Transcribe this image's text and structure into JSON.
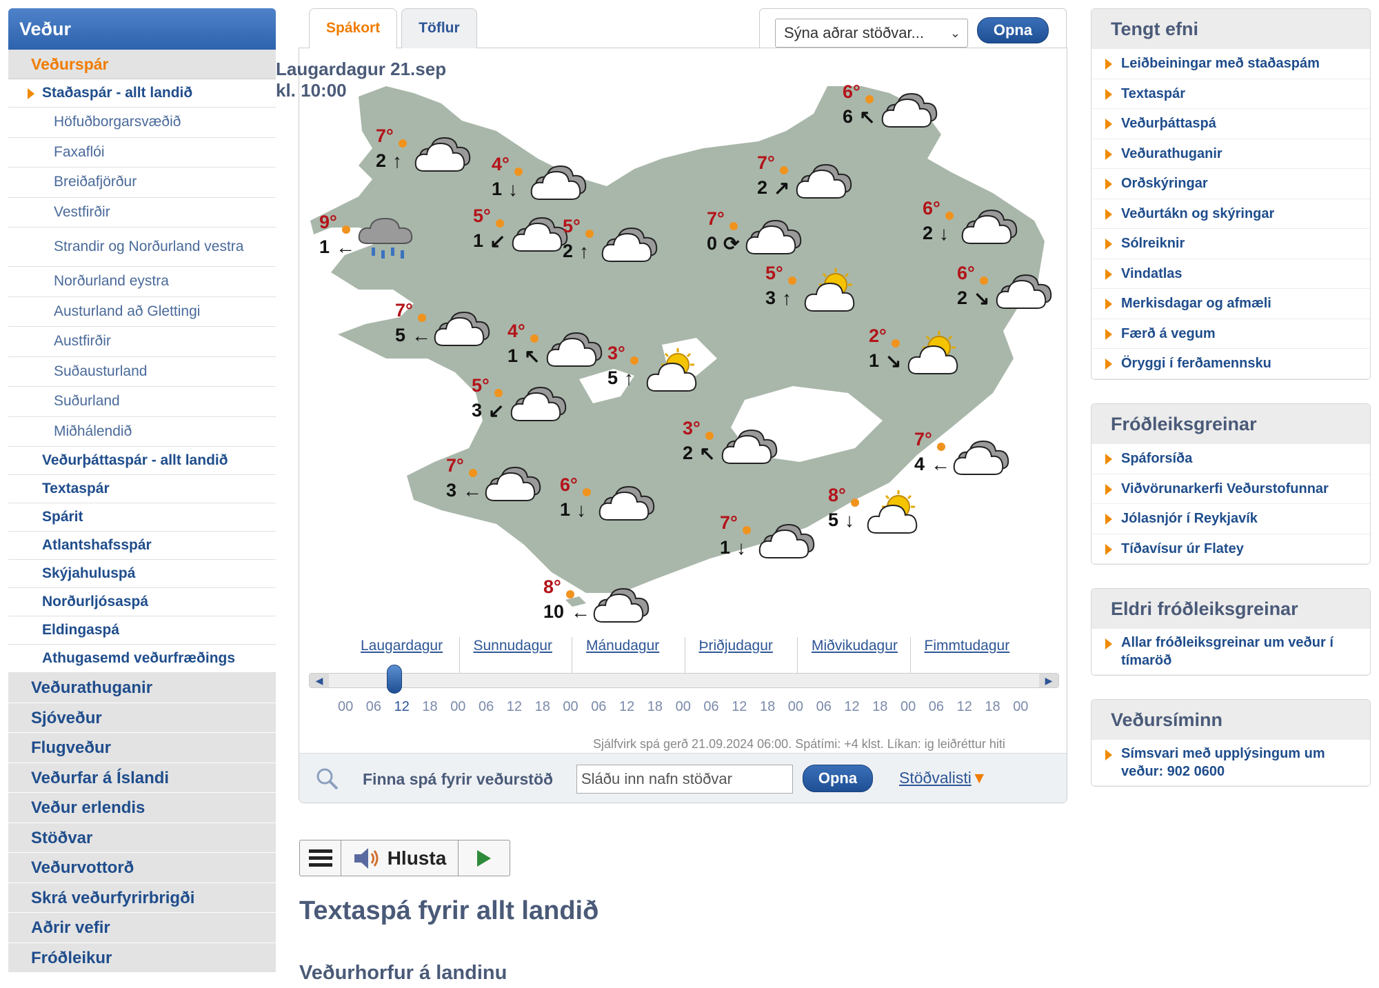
{
  "sidebar": {
    "header": "Veður",
    "section": "Veðurspár",
    "items": [
      {
        "label": "Staðaspár - allt landið",
        "level": 1,
        "active": true
      },
      {
        "label": "Höfuðborgarsvæðið",
        "level": 2
      },
      {
        "label": "Faxaflói",
        "level": 2
      },
      {
        "label": "Breiðafjörður",
        "level": 2
      },
      {
        "label": "Vestfirðir",
        "level": 2
      },
      {
        "label": "Strandir og Norðurland vestra",
        "level": 2
      },
      {
        "label": "Norðurland eystra",
        "level": 2
      },
      {
        "label": "Austurland að Glettingi",
        "level": 2
      },
      {
        "label": "Austfirðir",
        "level": 2
      },
      {
        "label": "Suðausturland",
        "level": 2
      },
      {
        "label": "Suðurland",
        "level": 2
      },
      {
        "label": "Miðhálendið",
        "level": 2
      },
      {
        "label": "Veðurþáttaspár - allt landið",
        "level": 1
      },
      {
        "label": "Textaspár",
        "level": 1
      },
      {
        "label": "Spárit",
        "level": 1
      },
      {
        "label": "Atlantshafsspár",
        "level": 1
      },
      {
        "label": "Skýjahuluspá",
        "level": 1
      },
      {
        "label": "Norðurljósaspá",
        "level": 1
      },
      {
        "label": "Eldingaspá",
        "level": 1
      },
      {
        "label": "Athugasemd veðurfræðings",
        "level": 1
      }
    ],
    "main": [
      "Veðurathuganir",
      "Sjóveður",
      "Flugveður",
      "Veðurfar á Íslandi",
      "Veður erlendis",
      "Stöðvar",
      "Veðurvottorð",
      "Skrá veðurfyrirbrigði",
      "Aðrir vefir",
      "Fróðleikur"
    ]
  },
  "map": {
    "tabs": [
      "Spákort",
      "Töflur"
    ],
    "station_select": "Sýna aðrar stöðvar...",
    "open_btn": "Opna",
    "title_line1": "Laugardagur 21.sep",
    "title_line2": "kl. 10:00",
    "stations": [
      {
        "temp": "7°",
        "wind": "2",
        "arrow": "↑",
        "icon": "cloudy"
      },
      {
        "temp": "4°",
        "wind": "1",
        "arrow": "↓",
        "icon": "cloudy"
      },
      {
        "temp": "9°",
        "wind": "1",
        "arrow": "←",
        "icon": "rain"
      },
      {
        "temp": "5°",
        "wind": "1",
        "arrow": "↙",
        "icon": "cloudy"
      },
      {
        "temp": "5°",
        "wind": "2",
        "arrow": "↑",
        "icon": "cloudy"
      },
      {
        "temp": "6°",
        "wind": "6",
        "arrow": "↖",
        "icon": "cloudy"
      },
      {
        "temp": "7°",
        "wind": "2",
        "arrow": "↗",
        "icon": "cloudy"
      },
      {
        "temp": "7°",
        "wind": "0",
        "arrow": "⟳",
        "icon": "cloudy"
      },
      {
        "temp": "6°",
        "wind": "2",
        "arrow": "↓",
        "icon": "cloudy"
      },
      {
        "temp": "5°",
        "wind": "3",
        "arrow": "↑",
        "icon": "partly-sunny"
      },
      {
        "temp": "6°",
        "wind": "2",
        "arrow": "↘",
        "icon": "cloudy"
      },
      {
        "temp": "7°",
        "wind": "5",
        "arrow": "←",
        "icon": "cloudy"
      },
      {
        "temp": "4°",
        "wind": "1",
        "arrow": "↖",
        "icon": "cloudy"
      },
      {
        "temp": "3°",
        "wind": "5",
        "arrow": "↑",
        "icon": "partly-sunny"
      },
      {
        "temp": "2°",
        "wind": "1",
        "arrow": "↘",
        "icon": "partly-sunny"
      },
      {
        "temp": "5°",
        "wind": "3",
        "arrow": "↙",
        "icon": "cloudy"
      },
      {
        "temp": "3°",
        "wind": "2",
        "arrow": "↖",
        "icon": "cloudy"
      },
      {
        "temp": "7°",
        "wind": "4",
        "arrow": "←",
        "icon": "cloudy"
      },
      {
        "temp": "7°",
        "wind": "3",
        "arrow": "←",
        "icon": "cloudy"
      },
      {
        "temp": "6°",
        "wind": "1",
        "arrow": "↓",
        "icon": "cloudy"
      },
      {
        "temp": "8°",
        "wind": "5",
        "arrow": "↓",
        "icon": "partly-sunny"
      },
      {
        "temp": "7°",
        "wind": "1",
        "arrow": "↓",
        "icon": "cloudy"
      },
      {
        "temp": "8°",
        "wind": "10",
        "arrow": "←",
        "icon": "cloudy"
      }
    ],
    "days": [
      "Laugardagur",
      "Sunnudagur",
      "Mánudagur",
      "Þriðjudagur",
      "Miðvikudagur",
      "Fimmtudagur"
    ],
    "hours": [
      "00",
      "06",
      "12",
      "18",
      "00",
      "06",
      "12",
      "18",
      "00",
      "06",
      "12",
      "18",
      "00",
      "06",
      "12",
      "18",
      "00",
      "06",
      "12",
      "18",
      "00",
      "06",
      "12",
      "18",
      "00"
    ],
    "footnote": "Sjálfvirk spá gerð 21.09.2024 06:00. Spátími: +4 klst. Líkan: ig leiðréttur hiti",
    "find_label": "Finna spá fyrir veðurstöð",
    "find_placeholder": "Sláðu inn nafn stöðvar",
    "find_btn": "Opna",
    "station_list": "Stöðvalisti"
  },
  "audio": {
    "label": "Hlusta"
  },
  "content": {
    "heading": "Textaspá fyrir allt landið",
    "subheading": "Veðurhorfur á landinu"
  },
  "right": {
    "tengt": {
      "title": "Tengt efni",
      "items": [
        "Leiðbeiningar með staðaspám",
        "Textaspár",
        "Veðurþáttaspá",
        "Veðurathuganir",
        "Orðskýringar",
        "Veðurtákn og skýringar",
        "Sólreiknir",
        "Vindatlas",
        "Merkisdagar og afmæli",
        "Færð á vegum",
        "Öryggi í ferðamennsku"
      ]
    },
    "frodleik": {
      "title": "Fróðleiksgreinar",
      "items": [
        "Spáforsíða",
        "Viðvörunarkerfi Veðurstofunnar",
        "Jólasnjór í Reykjavík",
        "Tíðavísur úr Flatey"
      ]
    },
    "eldri": {
      "title": "Eldri fróðleiksgreinar",
      "items": [
        "Allar fróðleiksgreinar um veður í tímaröð"
      ]
    },
    "simi": {
      "title": "Veðursíminn",
      "items": [
        "Símsvari með upplýsingum um veður: 902 0600"
      ]
    }
  },
  "colors": {
    "accent": "#f07c00",
    "brand": "#2d63ad",
    "land": "#a9b7aa",
    "temp": "#b3141a"
  }
}
